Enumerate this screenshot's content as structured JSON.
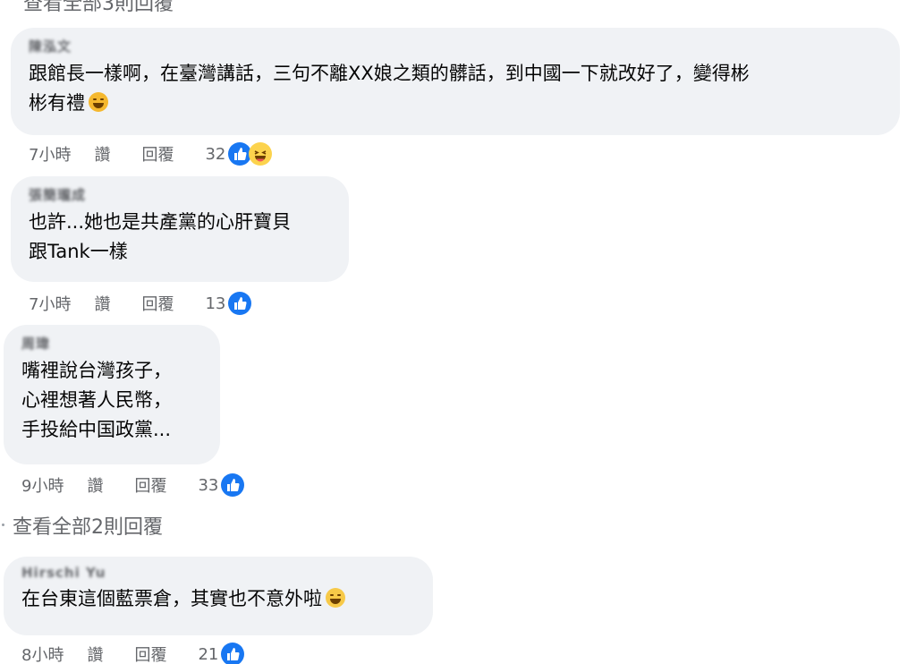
{
  "top_link": "查看全部3則回覆",
  "see_all": "查看全部2則回覆",
  "actions": {
    "like": "讚",
    "reply": "回覆"
  },
  "colors": {
    "bubble": "#f0f2f5",
    "meta_text": "#65676b",
    "like_blue": "#1877f2"
  },
  "comments": [
    {
      "author": "陳泓文",
      "text": "跟館長一樣啊，在臺灣講話，三句不離XX娘之類的髒話，到中國一下就改好了，變得彬\n彬有禮",
      "emoji": "rolling-laughing-emoji",
      "time": "7小時",
      "reaction_count": "32",
      "reactions": [
        "like-icon",
        "haha-icon"
      ]
    },
    {
      "author": "張簡瓏成",
      "text": "也許...她也是共產黨的心肝寶貝\n跟Tank一樣",
      "time": "7小時",
      "reaction_count": "13",
      "reactions": [
        "like-icon"
      ]
    },
    {
      "author": "周瑋",
      "text": "嘴裡說台灣孩子，\n心裡想著人民幣，\n手投給中国政黨...",
      "time": "9小時",
      "reaction_count": "33",
      "reactions": [
        "like-icon"
      ]
    },
    {
      "author": "Hirschi Yu",
      "text": "在台東這個藍票倉，其實也不意外啦",
      "emoji": "grinning-sweat-emoji",
      "time": "8小時",
      "reaction_count": "21",
      "reactions": [
        "like-icon"
      ]
    }
  ]
}
